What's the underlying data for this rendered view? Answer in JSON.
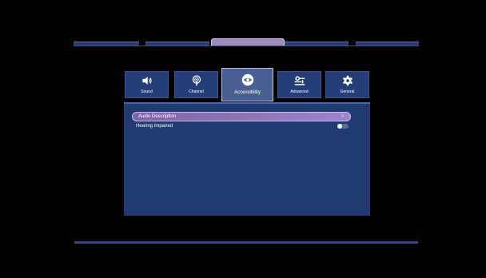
{
  "categories": [
    {
      "label": "Sound",
      "icon": "speaker-icon",
      "active": false
    },
    {
      "label": "Channel",
      "icon": "antenna-icon",
      "active": false
    },
    {
      "label": "Accessibility",
      "icon": "eye-icon",
      "active": true
    },
    {
      "label": "Advanced",
      "icon": "sliders-icon",
      "active": false
    },
    {
      "label": "General",
      "icon": "gear-icon",
      "active": false
    }
  ],
  "settings": {
    "audio_description": {
      "label": "Audio Description",
      "chevron": ">"
    },
    "hearing_impaired": {
      "label": "Hearing Impaired",
      "enabled": false
    }
  },
  "colors": {
    "background": "#000000",
    "panel": "#213a72",
    "tile": "#253e78",
    "tile_active": "#4a5f91",
    "highlight": "#9c84c8"
  }
}
